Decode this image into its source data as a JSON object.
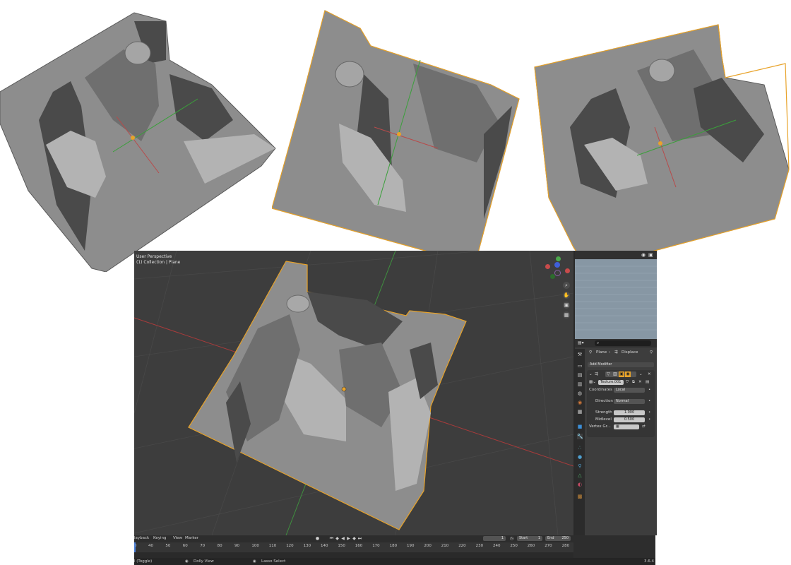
{
  "viewport": {
    "perspective_label": "User Perspective",
    "collection_label": "(1) Collection | Plane"
  },
  "properties": {
    "breadcrumb_object": "Plane",
    "breadcrumb_modifier": "Displace",
    "add_modifier_label": "Add Modifier",
    "texture_name": "Texture.001",
    "coordinates_label": "Coordinates",
    "coordinates_value": "Local",
    "direction_label": "Direction",
    "direction_value": "Normal",
    "strength_label": "Strength",
    "strength_value": "1.000",
    "midlevel_label": "Midlevel",
    "midlevel_value": "0.500",
    "vertex_group_label": "Vertex Gr..."
  },
  "timeline": {
    "playback_label": "layback",
    "keying_label": "Keying",
    "view_label": "View",
    "marker_label": "Marker",
    "current_frame": "1",
    "start_label": "Start",
    "start_value": "1",
    "end_label": "End",
    "end_value": "250",
    "ticks": [
      "0",
      "40",
      "50",
      "60",
      "70",
      "80",
      "90",
      "100",
      "110",
      "120",
      "130",
      "140",
      "150",
      "160",
      "170",
      "180",
      "190",
      "200",
      "210",
      "220",
      "230",
      "240",
      "250",
      "260",
      "270",
      "280"
    ]
  },
  "statusbar": {
    "toggle_label": "l (Toggle)",
    "dolly_label": "Dolly View",
    "lasso_label": "Lasso Select",
    "version": "3.6.4"
  },
  "colors": {
    "viewport_bg": "#3d3d3d",
    "outline_selected": "#e8a32a",
    "axis_x": "#c84b4b",
    "axis_y": "#4ca84c",
    "outliner_bg": "#8797a4",
    "accent_orange": "#e8a32a"
  },
  "icons": [
    "zoom-icon",
    "hand-icon",
    "camera-icon",
    "grid-icon",
    "wrench-icon",
    "search-icon",
    "eye-icon"
  ]
}
